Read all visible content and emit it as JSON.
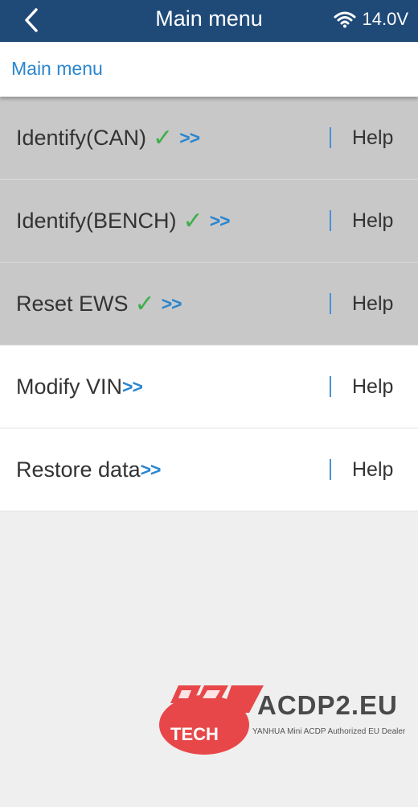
{
  "header": {
    "title": "Main menu",
    "voltage": "14.0V",
    "back_icon": "chevron-left-icon",
    "wifi_icon": "wifi-icon"
  },
  "breadcrumb": "Main menu",
  "menu": {
    "items": [
      {
        "label": "Identify(CAN)",
        "checked": true,
        "arrows": ">>",
        "help": "Help"
      },
      {
        "label": "Identify(BENCH)",
        "checked": true,
        "arrows": ">>",
        "help": "Help"
      },
      {
        "label": "Reset EWS",
        "checked": true,
        "arrows": ">>",
        "help": "Help"
      },
      {
        "label": "Modify VIN",
        "checked": false,
        "arrows": ">>",
        "help": "Help"
      },
      {
        "label": "Restore data",
        "checked": false,
        "arrows": ">>",
        "help": "Help"
      }
    ],
    "check_mark": "✓"
  },
  "watermark": {
    "logo_text": "YH TECH",
    "domain": "ACDP2.EU",
    "tagline": "YANHUA Mini ACDP Authorized EU Dealer"
  },
  "colors": {
    "header_bg": "#1f4a78",
    "accent_blue": "#2a86cf",
    "check_green": "#3fae49",
    "done_row_bg": "#c8c8c8",
    "logo_red": "#e8474a"
  }
}
